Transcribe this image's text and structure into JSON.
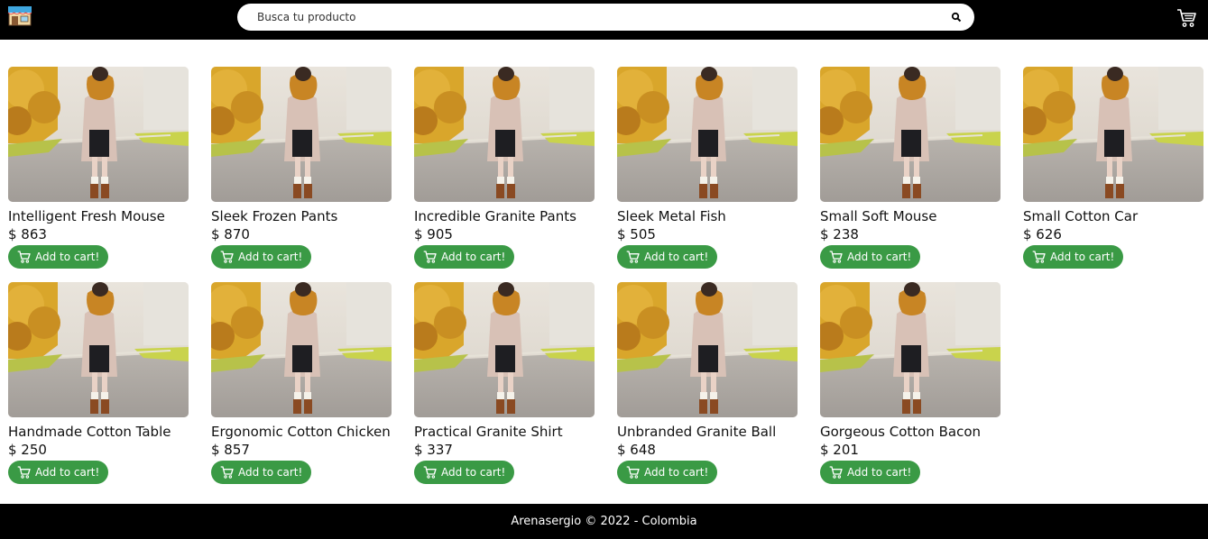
{
  "header": {
    "logo_icon": "store-icon",
    "search_placeholder": "Busca tu producto",
    "search_icon": "search-icon",
    "cart_icon": "shopping-cart-icon"
  },
  "products": [
    {
      "name": "Intelligent Fresh Mouse",
      "price": "$ 863",
      "button": "Add to cart!"
    },
    {
      "name": "Sleek Frozen Pants",
      "price": "$ 870",
      "button": "Add to cart!"
    },
    {
      "name": "Incredible Granite Pants",
      "price": "$ 905",
      "button": "Add to cart!"
    },
    {
      "name": "Sleek Metal Fish",
      "price": "$ 505",
      "button": "Add to cart!"
    },
    {
      "name": "Small Soft Mouse",
      "price": "$ 238",
      "button": "Add to cart!"
    },
    {
      "name": "Small Cotton Car",
      "price": "$ 626",
      "button": "Add to cart!"
    },
    {
      "name": "Handmade Cotton Table",
      "price": "$ 250",
      "button": "Add to cart!"
    },
    {
      "name": "Ergonomic Cotton Chicken",
      "price": "$ 857",
      "button": "Add to cart!"
    },
    {
      "name": "Practical Granite Shirt",
      "price": "$ 337",
      "button": "Add to cart!"
    },
    {
      "name": "Unbranded Granite Ball",
      "price": "$ 648",
      "button": "Add to cart!"
    },
    {
      "name": "Gorgeous Cotton Bacon",
      "price": "$ 201",
      "button": "Add to cart!"
    }
  ],
  "footer": {
    "text": "Arenasergio © 2022 - Colombia"
  },
  "colors": {
    "header_bg": "#000000",
    "button_green": "#3a9a45",
    "footer_bg": "#000000"
  }
}
